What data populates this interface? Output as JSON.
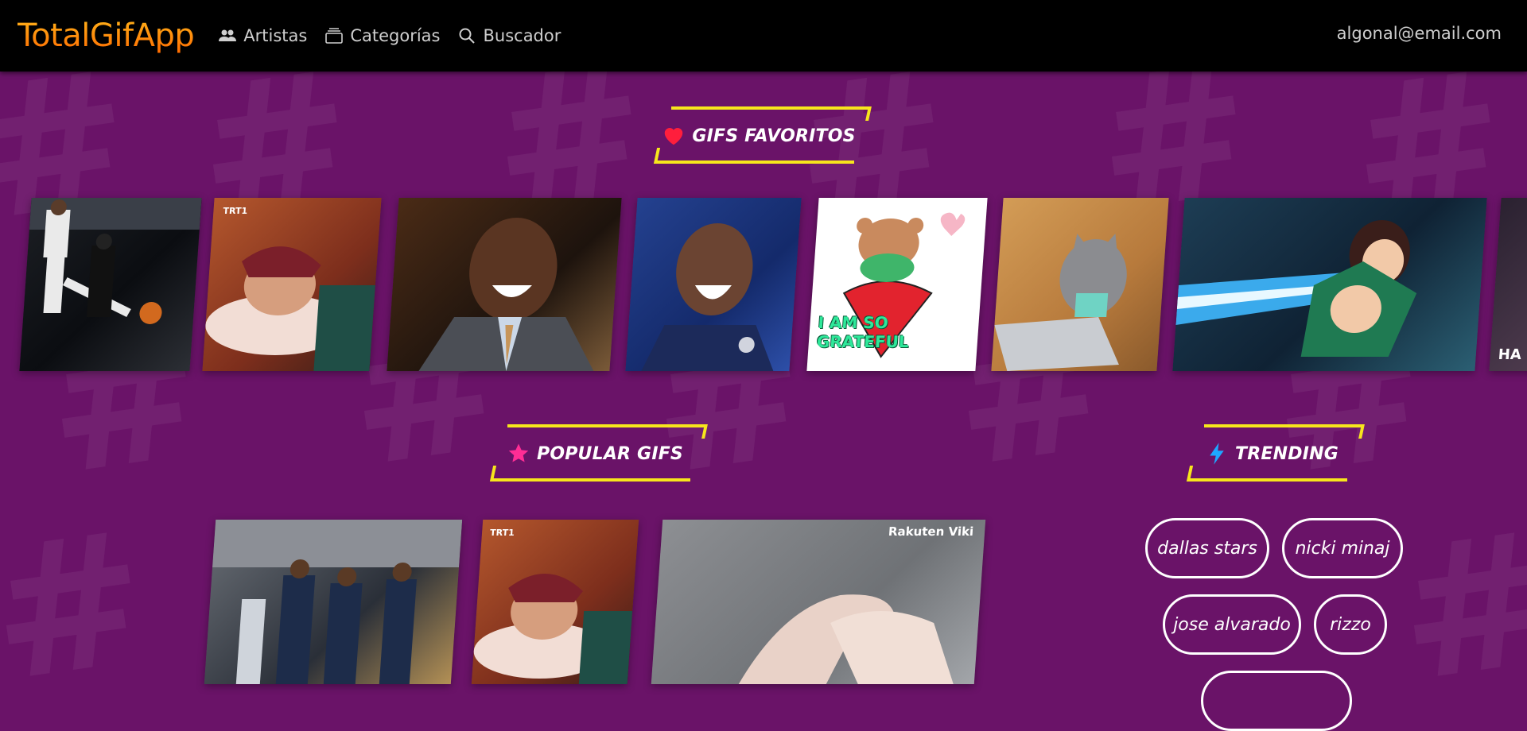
{
  "brand": "TotalGifApp",
  "nav": {
    "artists": "Artistas",
    "categories": "Categorías",
    "search": "Buscador"
  },
  "user": {
    "email": "algonal@email.com"
  },
  "sections": {
    "favorites": {
      "title": "GIFS FAVORITOS",
      "icon": "heart-icon"
    },
    "popular": {
      "title": "POPULAR GIFS",
      "icon": "star-icon"
    },
    "trending": {
      "title": "TRENDING",
      "icon": "lightning-icon"
    }
  },
  "favorite_gifs": [
    {
      "name": "basketball-player-gif",
      "caption": ""
    },
    {
      "name": "sleeping-man-gif",
      "caption": "TRT1"
    },
    {
      "name": "laughing-man-gif",
      "caption": ""
    },
    {
      "name": "crying-footballer-gif",
      "caption": ""
    },
    {
      "name": "grateful-bear-gif",
      "caption": "I AM SO GRATEFUL"
    },
    {
      "name": "cat-laptop-gif",
      "caption": ""
    },
    {
      "name": "anime-swordsman-gif",
      "caption": ""
    },
    {
      "name": "partial-gif",
      "caption": "HA"
    }
  ],
  "popular_gifs": [
    {
      "name": "basketball-team-gif",
      "caption": ""
    },
    {
      "name": "sleeping-man-gif-2",
      "caption": "TRT1"
    },
    {
      "name": "holding-hands-gif",
      "caption": "Rakuten Viki"
    }
  ],
  "trending_tags": [
    "dallas stars",
    "nicki minaj",
    "jose alvarado",
    "rizzo"
  ],
  "colors": {
    "background": "#6a1368",
    "navbar": "#000000",
    "accent_yellow": "#f7e61c",
    "brand_gradient": [
      "#ffb31a",
      "#ff6a00"
    ],
    "heart": "#ff1e3c",
    "star": "#ff2d95",
    "lightning": "#1ea7ff"
  }
}
